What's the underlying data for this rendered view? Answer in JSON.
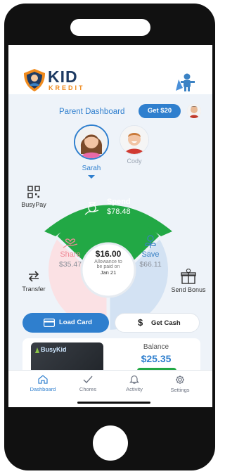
{
  "brand": {
    "name_top": "KID",
    "name_bottom": "KREDIT"
  },
  "header": {
    "title": "Parent Dashboard",
    "get_button": "Get $20"
  },
  "kids": [
    {
      "name": "Sarah",
      "selected": true
    },
    {
      "name": "Cody",
      "selected": false
    }
  ],
  "actions": {
    "busypay": "BusyPay",
    "transfer": "Transfer",
    "send_bonus": "Send Bonus"
  },
  "wheel": {
    "spend": {
      "label": "Spend",
      "amount": "$78.48"
    },
    "share": {
      "label": "Share",
      "amount": "$35.47"
    },
    "save": {
      "label": "Save",
      "amount": "$66.11"
    },
    "center": {
      "amount": "$16.00",
      "line1": "Allowance to",
      "line2": "be paid on",
      "date": "Jan 21"
    }
  },
  "cards": {
    "load_card": "Load Card",
    "get_cash": "Get Cash"
  },
  "card_panel": {
    "card_brand": "BusyKid",
    "balance_label": "Balance",
    "balance_value": "$25.35"
  },
  "tabs": [
    {
      "label": "Dashboard",
      "icon": "home-icon",
      "active": true
    },
    {
      "label": "Chores",
      "icon": "check-icon",
      "active": false
    },
    {
      "label": "Activity",
      "icon": "bell-icon",
      "active": false
    },
    {
      "label": "Settings",
      "icon": "gear-icon",
      "active": false
    }
  ],
  "colors": {
    "accent": "#2f7fce",
    "spend": "#22a845",
    "share": "#f3a3ad",
    "save": "#a9c9ee",
    "brand_orange": "#f08a1c"
  }
}
